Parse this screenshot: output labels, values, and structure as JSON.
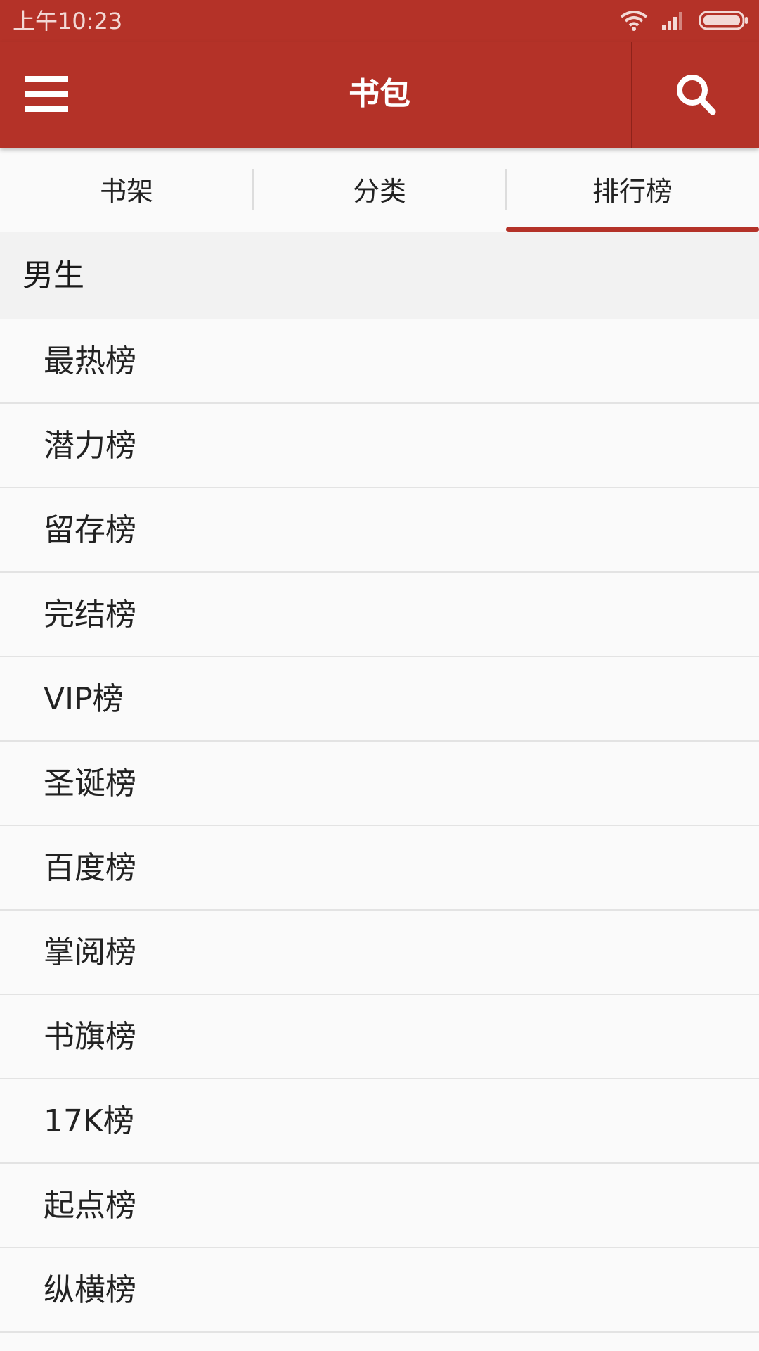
{
  "status_bar": {
    "time": "上午10:23"
  },
  "app_bar": {
    "title": "书包",
    "menu_icon": "hamburger-menu-icon",
    "search_icon": "search-icon"
  },
  "tabs": [
    {
      "label": "书架",
      "selected": false
    },
    {
      "label": "分类",
      "selected": false
    },
    {
      "label": "排行榜",
      "selected": true
    }
  ],
  "section": {
    "title": "男生"
  },
  "rank_items": [
    {
      "label": "最热榜"
    },
    {
      "label": "潜力榜"
    },
    {
      "label": "留存榜"
    },
    {
      "label": "完结榜"
    },
    {
      "label": "VIP榜"
    },
    {
      "label": "圣诞榜"
    },
    {
      "label": "百度榜"
    },
    {
      "label": "掌阅榜"
    },
    {
      "label": "书旗榜"
    },
    {
      "label": "17K榜"
    },
    {
      "label": "起点榜"
    },
    {
      "label": "纵横榜"
    }
  ],
  "colors": {
    "accent": "#b43228",
    "background": "#fafafa",
    "section_background": "#f2f2f2",
    "divider": "#e3e3e3"
  }
}
